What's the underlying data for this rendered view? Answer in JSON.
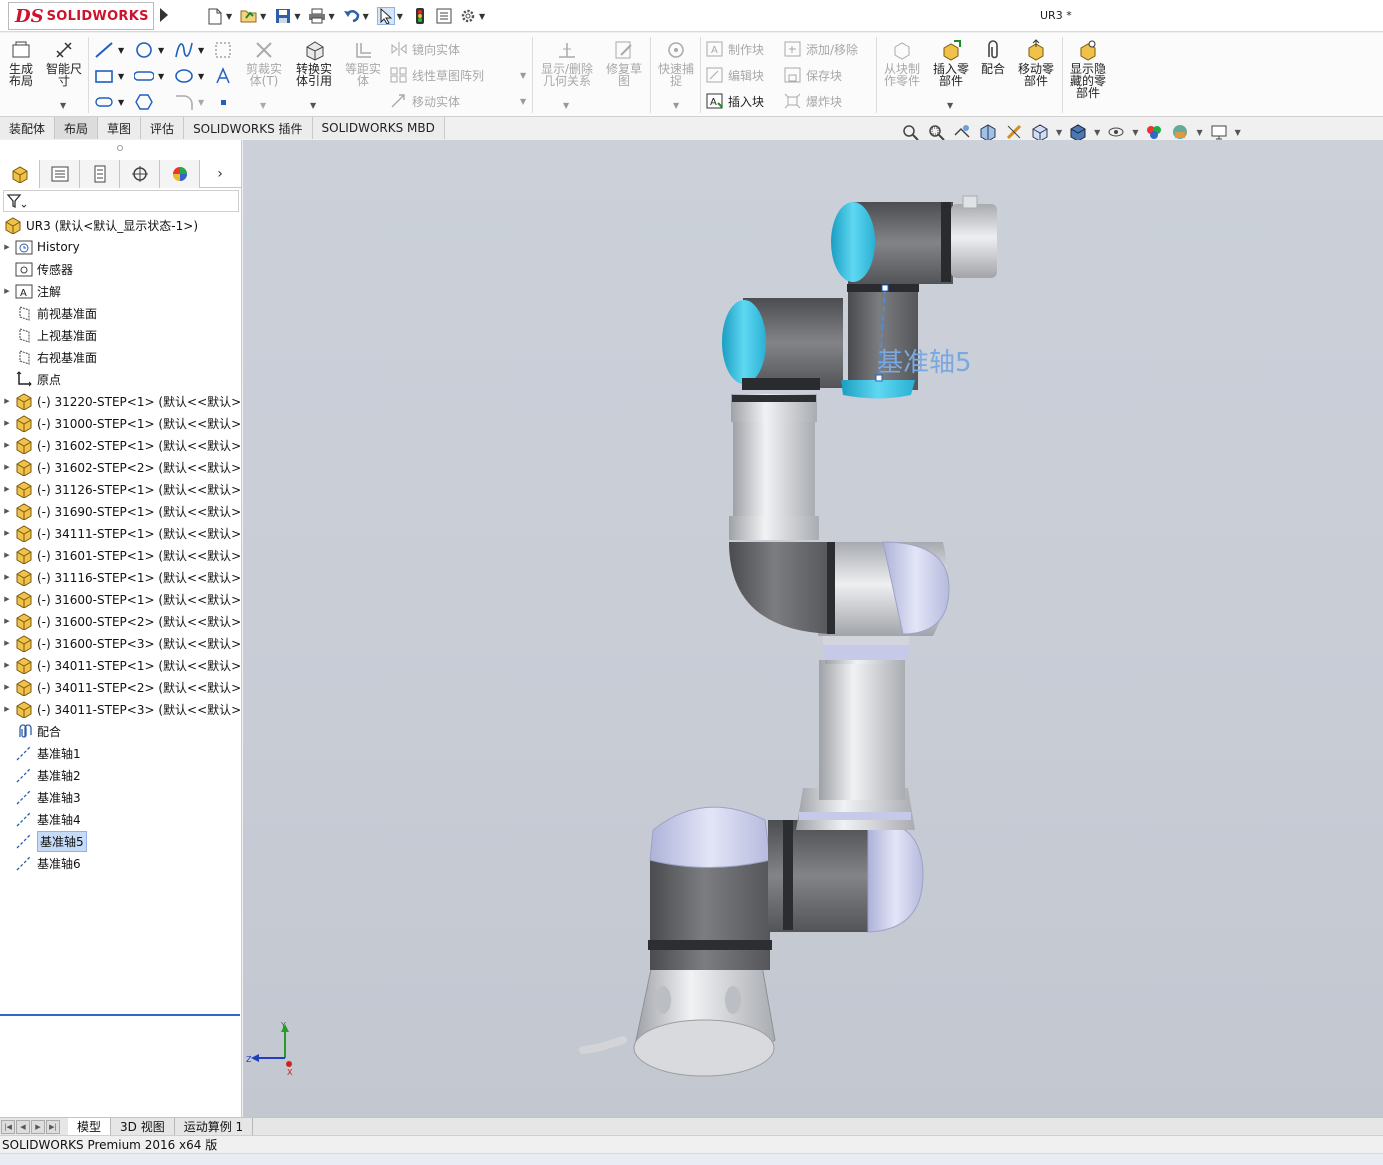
{
  "app": {
    "logo_prefix": "DS",
    "logo_text": "SOLIDWORKS",
    "document_title": "UR3 *"
  },
  "ribbon": {
    "generate_layout": "生成\n布局",
    "smart_dimension": "智能尺\n寸",
    "trim_entities": "剪裁实\n体(T)",
    "convert_entities": "转换实\n体引用",
    "offset_entities": "等距实\n体",
    "mirror_entities": "镜向实体",
    "linear_sketch_pattern": "线性草图阵列",
    "move_entities": "移动实体",
    "show_delete_relations": "显示/删除\n几何关系",
    "repair_sketch": "修复草\n图",
    "quick_snaps": "快速捕\n捉",
    "make_block": "制作块",
    "edit_block": "编辑块",
    "insert_block": "插入块",
    "add_remove": "添加/移除",
    "save_block": "保存块",
    "explode_block": "爆炸块",
    "make_part_from_block": "从块制\n作零件",
    "insert_components": "插入零\n部件",
    "mate": "配合",
    "move_component": "移动零\n部件",
    "show_hidden_components": "显示隐\n藏的零\n部件"
  },
  "tabs": [
    "装配体",
    "布局",
    "草图",
    "评估",
    "SOLIDWORKS 插件",
    "SOLIDWORKS MBD"
  ],
  "active_tab_index": 1,
  "tree": {
    "root": "UR3 (默认<默认_显示状态-1>)",
    "items": [
      {
        "label": "History",
        "icon": "history-folder-icon",
        "expandable": true
      },
      {
        "label": "传感器",
        "icon": "sensor-icon",
        "expandable": false
      },
      {
        "label": "注解",
        "icon": "annotation-icon",
        "expandable": true
      },
      {
        "label": "前视基准面",
        "icon": "plane-icon",
        "expandable": false
      },
      {
        "label": "上视基准面",
        "icon": "plane-icon",
        "expandable": false
      },
      {
        "label": "右视基准面",
        "icon": "plane-icon",
        "expandable": false
      },
      {
        "label": "原点",
        "icon": "origin-icon",
        "expandable": false
      },
      {
        "label": "(-) 31220-STEP<1> (默认<<默认>",
        "icon": "part-icon",
        "expandable": true
      },
      {
        "label": "(-) 31000-STEP<1> (默认<<默认>",
        "icon": "part-icon",
        "expandable": true
      },
      {
        "label": "(-) 31602-STEP<1> (默认<<默认>",
        "icon": "part-icon",
        "expandable": true
      },
      {
        "label": "(-) 31602-STEP<2> (默认<<默认>",
        "icon": "part-icon",
        "expandable": true
      },
      {
        "label": "(-) 31126-STEP<1> (默认<<默认>",
        "icon": "part-icon",
        "expandable": true
      },
      {
        "label": "(-) 31690-STEP<1> (默认<<默认>",
        "icon": "part-icon",
        "expandable": true
      },
      {
        "label": "(-) 34111-STEP<1> (默认<<默认>",
        "icon": "part-icon",
        "expandable": true
      },
      {
        "label": "(-) 31601-STEP<1> (默认<<默认>",
        "icon": "part-icon",
        "expandable": true
      },
      {
        "label": "(-) 31116-STEP<1> (默认<<默认>",
        "icon": "part-icon",
        "expandable": true
      },
      {
        "label": "(-) 31600-STEP<1> (默认<<默认>",
        "icon": "part-icon",
        "expandable": true
      },
      {
        "label": "(-) 31600-STEP<2> (默认<<默认>",
        "icon": "part-icon",
        "expandable": true
      },
      {
        "label": "(-) 31600-STEP<3> (默认<<默认>",
        "icon": "part-icon",
        "expandable": true
      },
      {
        "label": "(-) 34011-STEP<1> (默认<<默认>",
        "icon": "part-icon",
        "expandable": true
      },
      {
        "label": "(-) 34011-STEP<2> (默认<<默认>",
        "icon": "part-icon",
        "expandable": true
      },
      {
        "label": "(-) 34011-STEP<3> (默认<<默认>",
        "icon": "part-icon",
        "expandable": true
      },
      {
        "label": "配合",
        "icon": "mates-icon",
        "expandable": false
      },
      {
        "label": "基准轴1",
        "icon": "axis-icon",
        "expandable": false
      },
      {
        "label": "基准轴2",
        "icon": "axis-icon",
        "expandable": false
      },
      {
        "label": "基准轴3",
        "icon": "axis-icon",
        "expandable": false
      },
      {
        "label": "基准轴4",
        "icon": "axis-icon",
        "expandable": false
      },
      {
        "label": "基准轴5",
        "icon": "axis-icon",
        "expandable": false,
        "selected": true
      },
      {
        "label": "基准轴6",
        "icon": "axis-icon",
        "expandable": false
      }
    ]
  },
  "viewport": {
    "axis_label": "基准轴5",
    "triad": {
      "x": "X",
      "y": "Y",
      "z": "Z"
    }
  },
  "bottom_tabs": [
    "模型",
    "3D 视图",
    "运动算例 1"
  ],
  "active_bottom_tab_index": 0,
  "status": {
    "text": "SOLIDWORKS Premium 2016 x64 版"
  },
  "colors": {
    "accent_red": "#d0112b",
    "selection_blue": "#c6dbf5",
    "robot_cyan": "#3cc4e6",
    "robot_gray": "#6e6f73",
    "viewport_bg": "#c9cdd6"
  }
}
